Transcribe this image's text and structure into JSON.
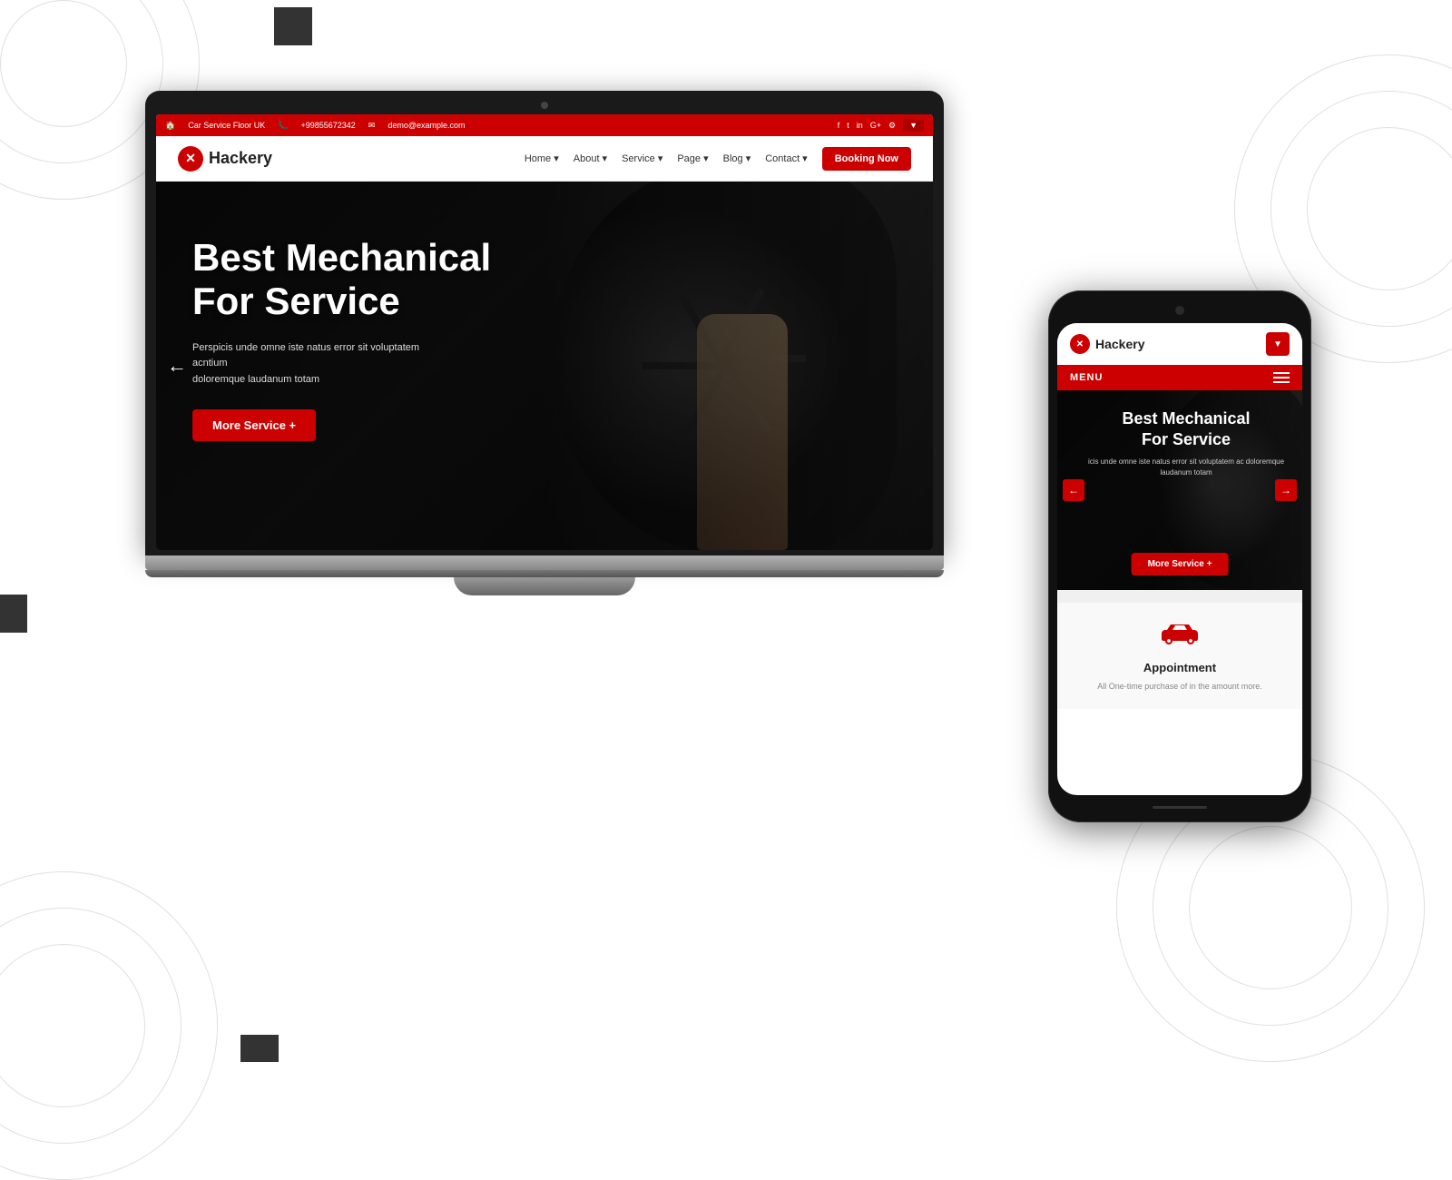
{
  "background": {
    "color": "#ffffff"
  },
  "laptop": {
    "topbar": {
      "address": "Car Service Floor UK",
      "phone": "+99855672342",
      "email": "demo@example.com"
    },
    "nav": {
      "logo_text": "Hackery",
      "menu_items": [
        "Home",
        "About",
        "Service",
        "Page",
        "Blog",
        "Contact"
      ],
      "booking_btn": "Booking Now"
    },
    "hero": {
      "title_line1": "Best Mechanical",
      "title_line2": "For Service",
      "description": "Perspicis unde omne iste natus error sit voluptatem acntium\ndoloremque laudanum totam",
      "cta_button": "More Service +"
    }
  },
  "phone": {
    "nav": {
      "logo_text": "Hackery"
    },
    "menu_bar": {
      "label": "MENU"
    },
    "hero": {
      "title_line1": "Best Mechanical",
      "title_line2": "For Service",
      "description": "icis unde omne iste natus error sit voluptatem ac doloremque laudanum totam",
      "cta_button": "More Service +"
    },
    "service_section": {
      "icon_label": "car",
      "title": "Appointment",
      "description": "All One-time purchase of in the amount more."
    }
  }
}
